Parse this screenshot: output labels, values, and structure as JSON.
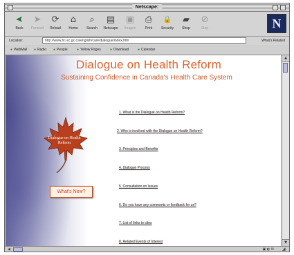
{
  "window": {
    "title": "Netscape:"
  },
  "toolbar": {
    "buttons": [
      {
        "label": "Back",
        "icon": "back-arrow-icon",
        "glyph": "➤",
        "enabled": true
      },
      {
        "label": "Forward",
        "icon": "forward-arrow-icon",
        "glyph": "➤",
        "enabled": false
      },
      {
        "label": "Reload",
        "icon": "reload-icon",
        "glyph": "⟳",
        "enabled": true
      },
      {
        "label": "Home",
        "icon": "home-icon",
        "glyph": "⌂",
        "enabled": true
      },
      {
        "label": "Search",
        "icon": "search-icon",
        "glyph": "⌕",
        "enabled": true
      },
      {
        "label": "Netscape",
        "icon": "netscape-icon",
        "glyph": "▤",
        "enabled": true
      },
      {
        "label": "Images",
        "icon": "images-icon",
        "glyph": "▣",
        "enabled": false
      },
      {
        "label": "Print",
        "icon": "print-icon",
        "glyph": "⎙",
        "enabled": true
      },
      {
        "label": "Security",
        "icon": "security-lock-icon",
        "glyph": "🔒",
        "enabled": true
      },
      {
        "label": "Shop",
        "icon": "shop-bag-icon",
        "glyph": "▰",
        "enabled": true
      },
      {
        "label": "Stop",
        "icon": "stop-icon",
        "glyph": "⊘",
        "enabled": false
      }
    ],
    "logo_letter": "N"
  },
  "location": {
    "label": "Location:",
    "url": "http://www.hc-sc.gc.ca/english/care/dialogue/index.htm",
    "related_label": "What's Related"
  },
  "personal_toolbar": {
    "items": [
      "WebMail",
      "Radio",
      "People",
      "Yellow Pages",
      "Download",
      "Calendar"
    ]
  },
  "page": {
    "title": "Dialogue on Health Reform",
    "subtitle": "Sustaining Confidence in Canada's Health Care System",
    "leaf_text": "Dialogue on Health Reform",
    "whats_new": "What's New?",
    "links": [
      "1. What is the Dialogue on Health Reform?",
      "2. Who is involved with the Dialogue on Health Reform?",
      "3. Principles and Benefits",
      "4. Dialogue Process",
      "5. Consultation on Issues",
      "6. Do you have any comments or feedback for us?",
      "7. List of links to sites",
      "8. Related Events of Interest"
    ]
  },
  "colors": {
    "title_orange": "#d9642f",
    "leaf_red": "#b8401c",
    "swirl_blue": "#6f6fa4"
  }
}
